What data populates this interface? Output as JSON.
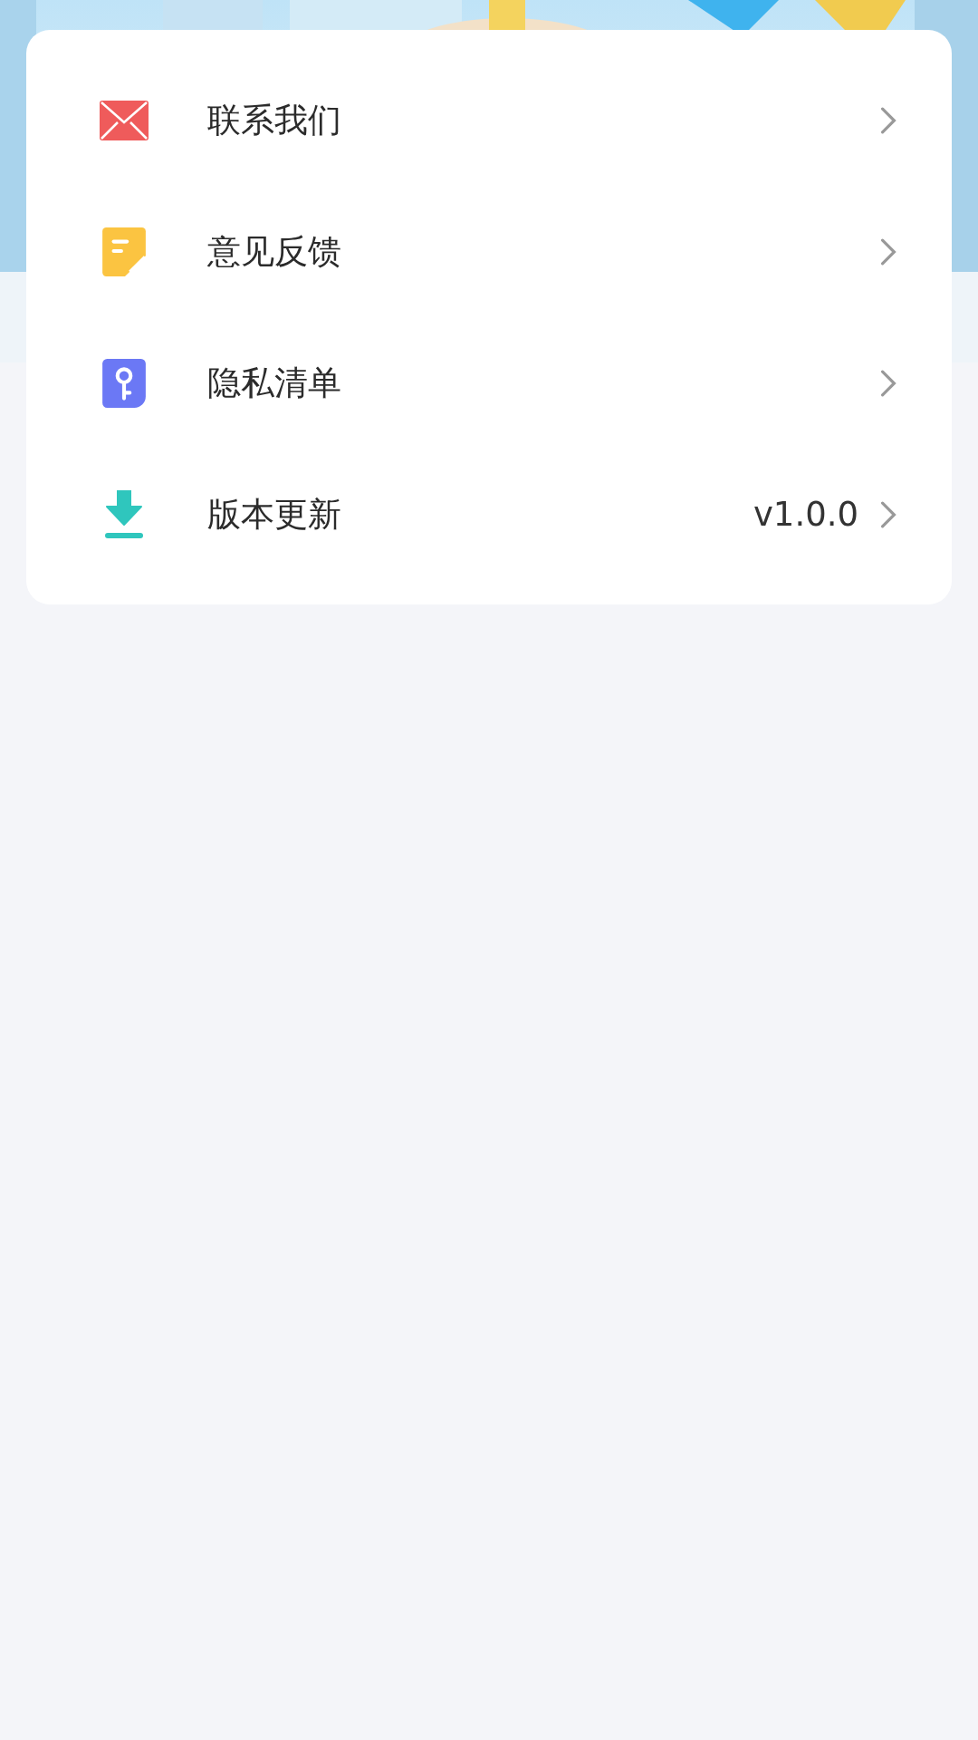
{
  "menu": [
    {
      "kind": "mail",
      "label": "联系我们"
    },
    {
      "kind": "note",
      "label": "意见反馈"
    },
    {
      "kind": "key",
      "label": "隐私清单"
    },
    {
      "kind": "download",
      "label": "版本更新",
      "value": "v1.0.0"
    }
  ]
}
